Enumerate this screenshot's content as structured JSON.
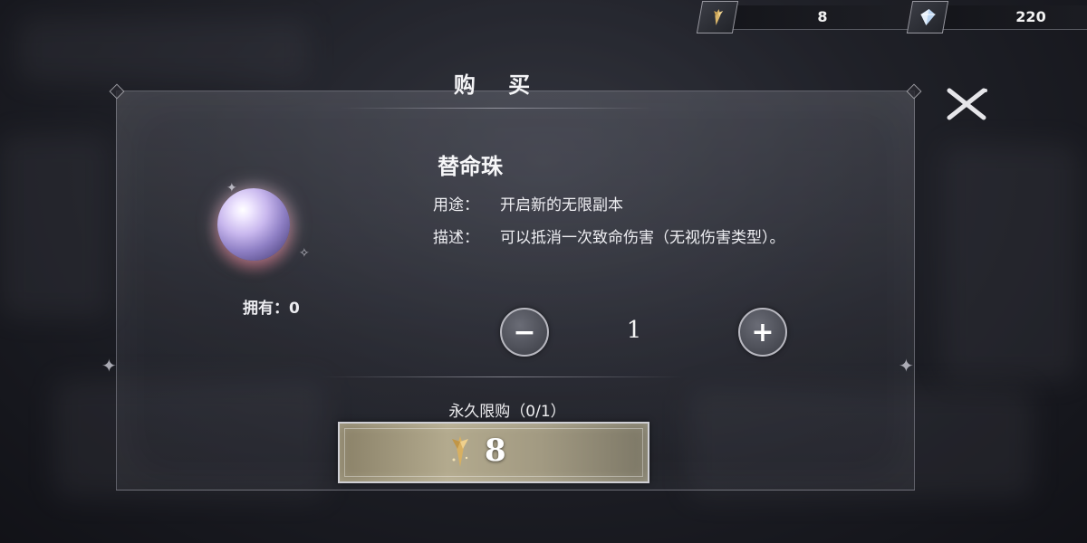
{
  "currencies": [
    {
      "icon": "gold-quill-icon",
      "value": "8"
    },
    {
      "icon": "crystal-icon",
      "value": "220"
    }
  ],
  "dialog": {
    "title": "购 买",
    "close_icon": "close-icon"
  },
  "item": {
    "name": "替命珠",
    "icon": "orb-icon",
    "owned_label": "拥有：0",
    "use_label": "用途：",
    "use_text": "开启新的无限副本",
    "desc_label": "描述：",
    "desc_text": "可以抵消一次致命伤害（无视伤害类型）。"
  },
  "quantity": {
    "minus_symbol": "−",
    "value": "1",
    "plus_symbol": "+"
  },
  "purchase": {
    "limit_text": "永久限购（0/1）",
    "price": "8",
    "price_icon": "gold-quill-icon"
  },
  "colors": {
    "button_gold": "#b3aa8e",
    "panel_border": "#d2d2dc"
  }
}
